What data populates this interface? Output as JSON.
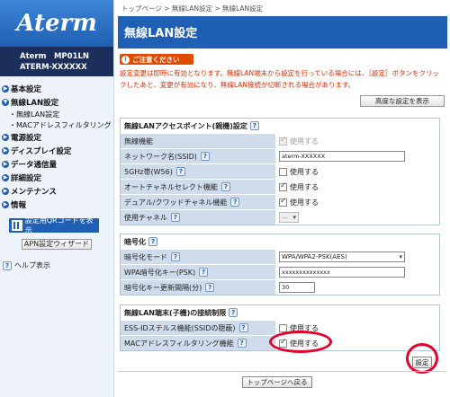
{
  "sidebar": {
    "logo": "Aterm",
    "model_line1": "Aterm　MP01LN",
    "model_line2": "ATERM-XXXXXX",
    "nav": [
      {
        "label": "基本設定"
      },
      {
        "label": "無線LAN設定"
      },
      {
        "label": "・無線LAN設定"
      },
      {
        "label": "・MACアドレスフィルタリング"
      },
      {
        "label": "電源設定"
      },
      {
        "label": "ディスプレイ設定"
      },
      {
        "label": "データ通信量"
      },
      {
        "label": "詳細設定"
      },
      {
        "label": "メンテナンス"
      },
      {
        "label": "情報"
      }
    ],
    "qr_button": "設定用QRコードを表示",
    "apn_button": "APN設定ウィザード",
    "help_link": "ヘルプ表示"
  },
  "main": {
    "breadcrumb": "トップページ > 無線LAN設定 > 無線LAN設定",
    "title": "無線LAN設定",
    "caution_label": "ご注意ください",
    "caution_text": "設定変更は即時に有効となります。無線LAN端末から設定を行っている場合には、［設定］ボタンをクリックしたあと、変更が有効になり、無線LAN接続が切断される場合があります。",
    "advanced_button": "高度な設定を表示",
    "section1": {
      "title": "無線LANアクセスポイント(親機)設定",
      "rows": [
        {
          "label": "無線機能",
          "value": "使用する"
        },
        {
          "label": "ネットワーク名(SSID)",
          "value": "aterm-XXXXXX"
        },
        {
          "label": "5GHz帯(W56)",
          "value": "使用する"
        },
        {
          "label": "オートチャネルセレクト機能",
          "value": "使用する"
        },
        {
          "label": "デュアル/クワッドチャネル機能",
          "value": "使用する"
        },
        {
          "label": "使用チャネル",
          "value": "—"
        }
      ]
    },
    "section2": {
      "title": "暗号化",
      "rows": [
        {
          "label": "暗号化モード",
          "value": "WPA/WPA2-PSK(AES)"
        },
        {
          "label": "WPA暗号化キー(PSK)",
          "value": "xxxxxxxxxxxxxx"
        },
        {
          "label": "暗号化キー更新間隔(分)",
          "value": "30"
        }
      ]
    },
    "section3": {
      "title": "無線LAN端末(子機)の接続制限",
      "rows": [
        {
          "label": "ESS-IDステルス機能(SSIDの隠蔽)",
          "value": "使用する"
        },
        {
          "label": "MACアドレスフィルタリング機能",
          "value": "使用する"
        }
      ]
    },
    "settings_button": "設定",
    "top_button": "トップページへ戻る"
  },
  "help_glyph": "?",
  "colors": {
    "brand_blue": "#1f5fb4",
    "caution_red": "#e02b00",
    "highlight_red": "#e8002a"
  }
}
